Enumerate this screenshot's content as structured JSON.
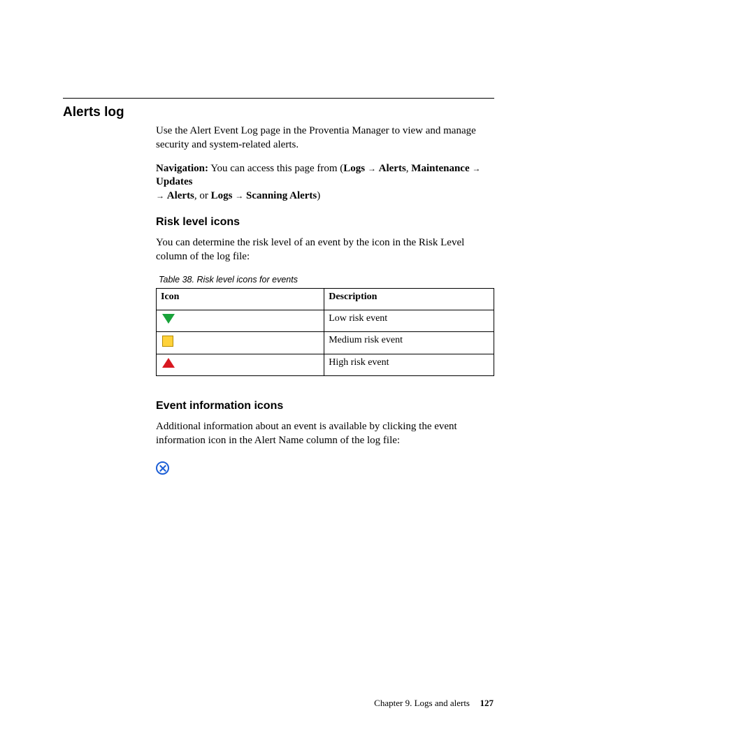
{
  "title": "Alerts log",
  "intro": "Use the Alert Event Log page in the Proventia Manager to view and manage security and system-related alerts.",
  "nav": {
    "label": "Navigation:",
    "lead": " You can access this page from (",
    "p1a": "Logs",
    "p1b": "Alerts",
    "sep1": ", ",
    "p2a": "Maintenance",
    "p2b": "Updates",
    "p2c": "Alerts",
    "sep2": ", or ",
    "p3a": "Logs",
    "p3b": "Scanning Alerts",
    "tail": ")"
  },
  "arrow": "→",
  "section1": {
    "heading": "Risk level icons",
    "text": "You can determine the risk level of an event by the icon in the Risk Level column of the log file:",
    "caption": "Table 38. Risk level icons for events",
    "col_icon": "Icon",
    "col_desc": "Description",
    "rows": {
      "low": "Low risk event",
      "medium": "Medium risk event",
      "high": "High risk event"
    }
  },
  "section2": {
    "heading": "Event information icons",
    "text": "Additional information about an event is available by clicking the event information icon in the Alert Name column of the log file:"
  },
  "footer": {
    "chapter": "Chapter 9. Logs and alerts",
    "page": "127"
  }
}
